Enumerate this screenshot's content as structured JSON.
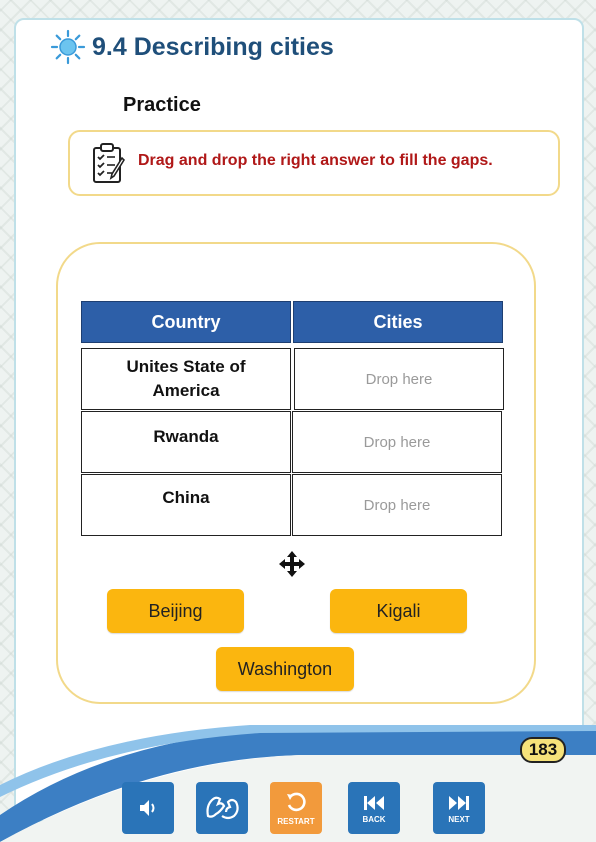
{
  "header": {
    "title": "9.4 Describing cities",
    "section": "Practice"
  },
  "instruction": "Drag and drop the right answer to fill the gaps.",
  "table": {
    "headers": [
      "Country",
      "Cities"
    ],
    "rows": [
      {
        "country": "Unites State of America",
        "drop": "Drop here"
      },
      {
        "country": "Rwanda",
        "drop": "Drop here"
      },
      {
        "country": "China",
        "drop": "Drop here"
      }
    ]
  },
  "options": [
    "Beijing",
    "Kigali",
    "Washington"
  ],
  "page_number": "183",
  "toolbar": {
    "audio_icon": "speaker-icon",
    "sign_icon": "sign-language-icon",
    "restart_label": "RESTART",
    "back_label": "BACK",
    "next_label": "NEXT"
  },
  "colors": {
    "title": "#1f4f7a",
    "instruction": "#b01818",
    "table_header": "#2d5fa8",
    "chip": "#fbb60f",
    "button": "#2a74b8",
    "restart": "#f29a3c"
  }
}
